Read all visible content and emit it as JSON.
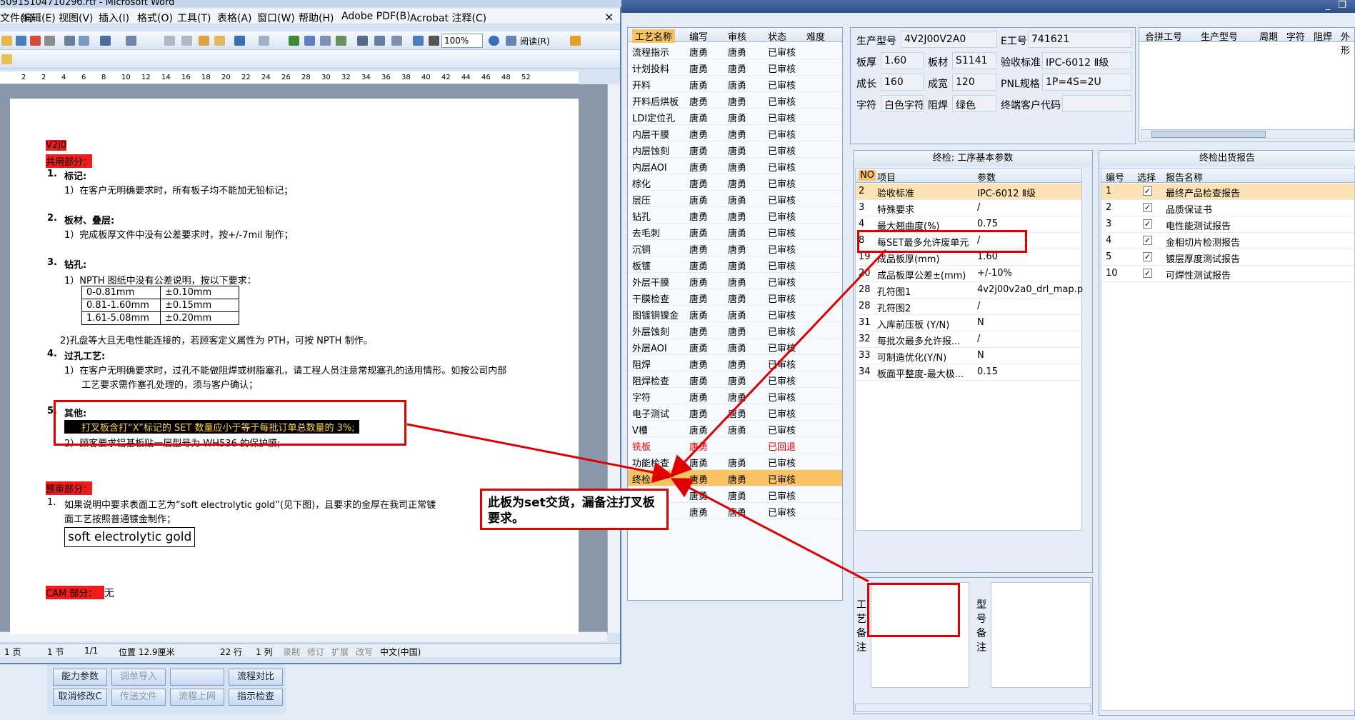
{
  "word": {
    "title": "5091510471029б.rtf - Microsoft Word",
    "menu": [
      "文件(F)",
      "编辑(E)",
      "视图(V)",
      "插入(I)",
      "格式(O)",
      "工具(T)",
      "表格(A)",
      "窗口(W)",
      "帮助(H)",
      "Adobe PDF(B)",
      "Acrobat 注释(C)"
    ],
    "close": "×",
    "zoom": "100%",
    "reading": "阅读(R)",
    "ruler": [
      "2",
      "2",
      "4",
      "6",
      "8",
      "10",
      "12",
      "14",
      "16",
      "18",
      "20",
      "22",
      "24",
      "26",
      "28",
      "30",
      "32",
      "34",
      "36",
      "38",
      "40",
      "42",
      "44",
      "46",
      "48",
      "52"
    ],
    "doc": {
      "l1": "V2j0",
      "l2": "共用部分：",
      "s1": "1.",
      "h1": "标记:",
      "t1": "1）在客户无明确要求时，所有板子均不能加无铅标记；",
      "s2": "2.",
      "h2": "板材、叠层:",
      "t2": "1）完成板厚文件中没有公差要求时，按+/-7mil 制作；",
      "s3": "3.",
      "h3": "钻孔:",
      "t3": "1）NPTH 图纸中没有公差说明，按以下要求：",
      "tbl": [
        [
          "0-0.81mm",
          "±0.10mm"
        ],
        [
          "0.81-1.60mm",
          "±0.15mm"
        ],
        [
          "1.61-5.08mm",
          "±0.20mm"
        ]
      ],
      "t3b": "2)孔盘等大且无电性能连接的，若顾客定义属性为 PTH，可按 NPTH 制作。",
      "s4": "4.",
      "h4": "过孔工艺:",
      "t4a": "1）在客户无明确要求时，过孔不能做阻焊或树脂塞孔，请工程人员注意常规塞孔的适用情形。如按公司内部",
      "t4b": "工艺要求需作塞孔处理的，须与客户确认；",
      "s5": "5.",
      "h5": "其他:",
      "t5a": "打叉板含打“X”标记的 SET 数量应小于等于每批订单总数量的 3%;",
      "t5b": "2）顾客要求铝基板贴一层型号为 WH536 的保护膜;",
      "l3": "预审部分：",
      "p1s": "1.",
      "p1a": "如果说明中要求表面工艺为“soft electrolytic gold”(见下图)，且要求的金厚在我司正常镀",
      "p1b": "面工艺按照普通镀金制作；",
      "img": "soft electrolytic gold",
      "l4": "CAM 部分：",
      "l4v": "无"
    },
    "status": {
      "page": "1 页",
      "sec": "1 节",
      "pp": "1/1",
      "pos": "位置 12.9厘米",
      "line": "22 行",
      "col": "1 列",
      "rec": "录制",
      "rev": "修订",
      "ext": "扩展",
      "ovr": "改写",
      "lang": "中文(中国)"
    }
  },
  "process": {
    "headers": [
      "工艺名称",
      "编写",
      "审核",
      "状态",
      "难度"
    ],
    "rows": [
      [
        "流程指示",
        "唐勇",
        "唐勇",
        "已审核"
      ],
      [
        "计划投料",
        "唐勇",
        "唐勇",
        "已审核"
      ],
      [
        "开料",
        "唐勇",
        "唐勇",
        "已审核"
      ],
      [
        "开料后烘板",
        "唐勇",
        "唐勇",
        "已审核"
      ],
      [
        "LDI定位孔",
        "唐勇",
        "唐勇",
        "已审核"
      ],
      [
        "内层干膜",
        "唐勇",
        "唐勇",
        "已审核"
      ],
      [
        "内层蚀刻",
        "唐勇",
        "唐勇",
        "已审核"
      ],
      [
        "内层AOI",
        "唐勇",
        "唐勇",
        "已审核"
      ],
      [
        "棕化",
        "唐勇",
        "唐勇",
        "已审核"
      ],
      [
        "层压",
        "唐勇",
        "唐勇",
        "已审核"
      ],
      [
        "钻孔",
        "唐勇",
        "唐勇",
        "已审核"
      ],
      [
        "去毛刺",
        "唐勇",
        "唐勇",
        "已审核"
      ],
      [
        "沉铜",
        "唐勇",
        "唐勇",
        "已审核"
      ],
      [
        "板镀",
        "唐勇",
        "唐勇",
        "已审核"
      ],
      [
        "外层干膜",
        "唐勇",
        "唐勇",
        "已审核"
      ],
      [
        "干膜检查",
        "唐勇",
        "唐勇",
        "已审核"
      ],
      [
        "图镀铜镍金",
        "唐勇",
        "唐勇",
        "已审核"
      ],
      [
        "外层蚀刻",
        "唐勇",
        "唐勇",
        "已审核"
      ],
      [
        "外层AOI",
        "唐勇",
        "唐勇",
        "已审核"
      ],
      [
        "阻焊",
        "唐勇",
        "唐勇",
        "已审核"
      ],
      [
        "阻焊检查",
        "唐勇",
        "唐勇",
        "已审核"
      ],
      [
        "字符",
        "唐勇",
        "唐勇",
        "已审核"
      ],
      [
        "电子测试",
        "唐勇",
        "唐勇",
        "已审核"
      ],
      [
        "V槽",
        "唐勇",
        "唐勇",
        "已审核"
      ],
      [
        "铣板",
        "唐勇",
        "",
        "已回退"
      ],
      [
        "功能检查",
        "唐勇",
        "唐勇",
        "已审核"
      ],
      [
        "终检",
        "唐勇",
        "唐勇",
        "已审核"
      ],
      [
        "",
        "唐勇",
        "唐勇",
        "已审核"
      ],
      [
        "",
        "唐勇",
        "唐勇",
        "已审核"
      ]
    ]
  },
  "info": {
    "model_l": "生产型号",
    "model": "4V2J00V2A0",
    "e_l": "E工号",
    "e": "741621",
    "thick_l": "板厚",
    "thick": "1.60",
    "mat_l": "板材",
    "mat": "S1141",
    "std_l": "验收标准",
    "std": "IPC-6012 Ⅱ级",
    "len_l": "成长",
    "len": "160",
    "wid_l": "成宽",
    "wid": "120",
    "pnl_l": "PNL规格",
    "pnl": "1P=4S=2U",
    "char_l": "字符",
    "char": "白色字符",
    "mask_l": "阻焊",
    "mask": "绿色",
    "cust_l": "终端客户代码",
    "cust": ""
  },
  "combo": {
    "headers": [
      "合拼工号",
      "生产型号",
      "周期",
      "字符",
      "阻焊",
      "外形"
    ]
  },
  "params": {
    "title": "终检: 工序基本参数",
    "headers": [
      "NO",
      "项目",
      "参数"
    ],
    "rows": [
      [
        "2",
        "验收标准",
        "IPC-6012 Ⅱ级"
      ],
      [
        "3",
        "特殊要求",
        "/"
      ],
      [
        "4",
        "最大翘曲度(%)",
        "0.75"
      ],
      [
        "8",
        "每SET最多允许废单元",
        "/"
      ],
      [
        "19",
        "成品板厚(mm)",
        "1.60"
      ],
      [
        "20",
        "成品板厚公差±(mm)",
        "+/-10%"
      ],
      [
        "28",
        "孔符图1",
        "4v2j00v2a0_drl_map.p"
      ],
      [
        "28",
        "孔符图2",
        "/"
      ],
      [
        "31",
        "入库前压板 (Y/N)",
        "N"
      ],
      [
        "32",
        "每批次最多允许报...",
        "/"
      ],
      [
        "33",
        "可制造优化(Y/N)",
        "N"
      ],
      [
        "34",
        "板面平整度-最大极...",
        "0.15"
      ]
    ]
  },
  "reports": {
    "title": "终检出货报告",
    "headers": [
      "编号",
      "选择",
      "报告名称"
    ],
    "rows": [
      [
        "1",
        "最终产品检查报告"
      ],
      [
        "2",
        "品质保证书"
      ],
      [
        "3",
        "电性能测试报告"
      ],
      [
        "4",
        "金相切片检测报告"
      ],
      [
        "5",
        "镀层厚度测试报告"
      ],
      [
        "10",
        "可焊性测试报告"
      ]
    ],
    "check": "✓"
  },
  "remarks": {
    "process": "工艺备注",
    "model": "型号备注"
  },
  "buttons": {
    "b1": "能力参数",
    "b2": "调单导入",
    "b3": "",
    "b4": "流程对比",
    "b5": "取消修改C",
    "b6": "传送文件",
    "b7": "流程上网",
    "b8": "指示检查"
  },
  "annotation": "此板为set交货，漏备注打叉板要求。",
  "colors": {
    "annotation": "#e00000",
    "selected": "#f9c363",
    "highlight": "#f01b1b"
  }
}
